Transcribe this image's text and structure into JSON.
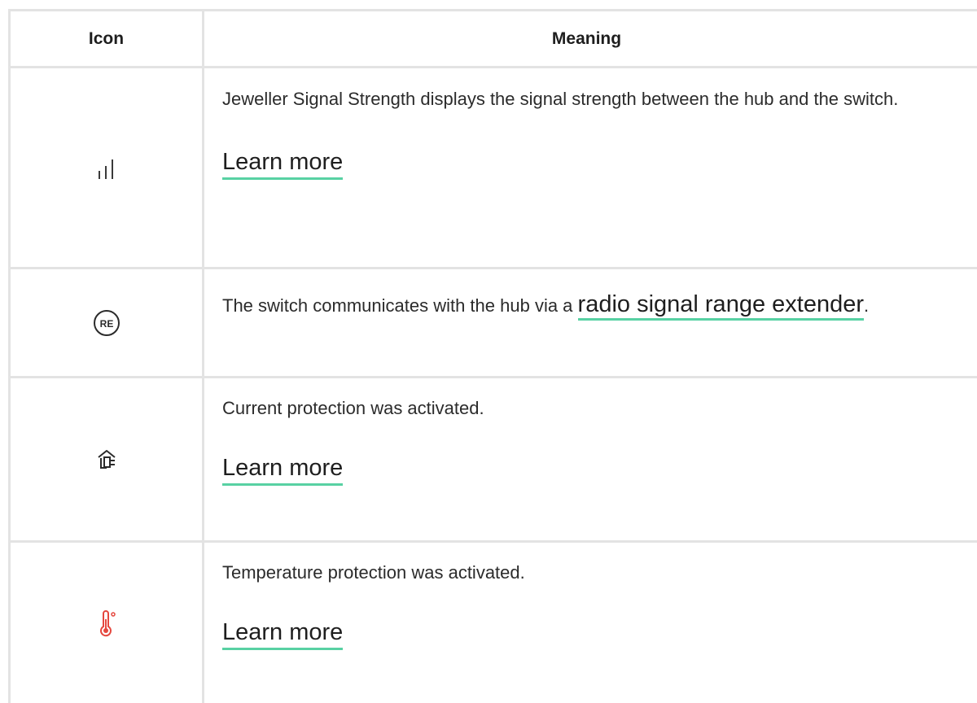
{
  "header": {
    "icon_col": "Icon",
    "meaning_col": "Meaning"
  },
  "rows": [
    {
      "icon": "signal-strength-icon",
      "text": "Jeweller Signal Strength displays the signal strength between the hub and the switch.",
      "link": "Learn more"
    },
    {
      "icon": "range-extender-icon",
      "icon_text": "RE",
      "text_before": "The switch communicates with the hub via a ",
      "link": "radio signal range extender",
      "text_after": "."
    },
    {
      "icon": "current-protection-icon",
      "text": "Current protection was activated.",
      "link": "Learn more"
    },
    {
      "icon": "temperature-protection-icon",
      "text": "Temperature protection was activated.",
      "link": "Learn more"
    }
  ],
  "colors": {
    "link_underline": "#58d1a3",
    "border": "#e3e3e3",
    "temperature_icon": "#e5483f"
  }
}
